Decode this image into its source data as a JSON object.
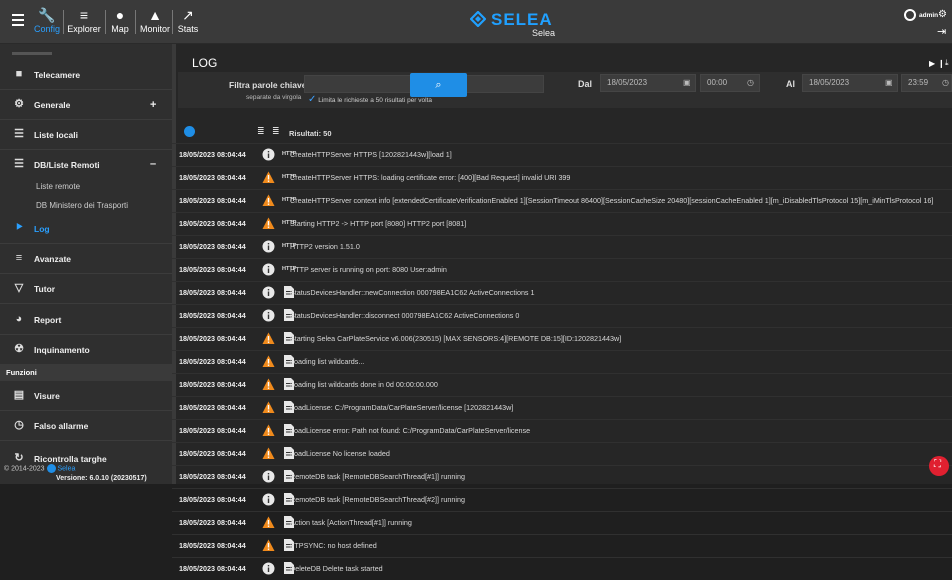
{
  "topbar": {
    "items": [
      {
        "label": "Config",
        "icon": "wrench-icon"
      },
      {
        "label": "Explorer",
        "icon": "list-search-icon"
      },
      {
        "label": "Map",
        "icon": "map-pin-icon"
      },
      {
        "label": "Monitor",
        "icon": "bell-icon"
      },
      {
        "label": "Stats",
        "icon": "chart-icon"
      }
    ],
    "brand": "SELEA",
    "brand_sub": "Selea",
    "user": "admin",
    "accent": "#1f8ee6"
  },
  "sidebar": {
    "items": [
      {
        "label": "Telecamere",
        "icon": "camera-icon"
      },
      {
        "label": "Generale",
        "icon": "gear-icon",
        "toggle": "+"
      },
      {
        "label": "Liste locali",
        "icon": "list-icon"
      },
      {
        "label": "DB/Liste Remoti",
        "icon": "menu-icon",
        "toggle": "–"
      },
      {
        "label": "Log",
        "icon": "key-icon"
      },
      {
        "label": "Avanzate",
        "icon": "sliders-icon"
      },
      {
        "label": "Tutor",
        "icon": "signal-icon"
      },
      {
        "label": "Report",
        "icon": "pie-icon"
      },
      {
        "label": "Inquinamento",
        "icon": "biohazard-icon"
      },
      {
        "label": "Visure",
        "icon": "card-icon"
      },
      {
        "label": "Falso allarme",
        "icon": "clock-icon"
      },
      {
        "label": "Ricontrolla targhe",
        "icon": "refresh-icon"
      }
    ],
    "subitems": [
      "Liste remote",
      "DB Ministero dei Trasporti"
    ],
    "section": "Funzioni",
    "footer_copy": "© 2014-2023",
    "footer_brand": "Selea",
    "version": "Versione: 6.0.10 (20230517)"
  },
  "main": {
    "title": "LOG",
    "filter_label": "Filtra parole chiave",
    "filter_sub": "separate da virgola",
    "limit_label": "Limita le richieste a 50 risultati per volta",
    "from_label": "Dal",
    "to_label": "Al",
    "from_date": "18/05/2023",
    "from_time": "00:00",
    "to_date": "18/05/2023",
    "to_time": "23:59",
    "results": "Risultati: 50"
  },
  "rows": [
    {
      "ts": "18/05/2023 08:04:44",
      "level": "info",
      "cat": "HTTP",
      "msg": "CreateHTTPServer HTTPS [1202821443w][load 1]"
    },
    {
      "ts": "18/05/2023 08:04:44",
      "level": "warn",
      "cat": "HTTP",
      "msg": "CreateHTTPServer HTTPS: loading certificate error: [400][Bad Request] invalid URI 399"
    },
    {
      "ts": "18/05/2023 08:04:44",
      "level": "warn",
      "cat": "HTTP",
      "msg": "CreateHTTPServer context info [extendedCertificateVerificationEnabled 1][SessionTimeout 86400][SessionCacheSize 20480][sessionCacheEnabled 1][m_iDisabledTlsProtocol 15][m_iMinTlsProtocol 16]"
    },
    {
      "ts": "18/05/2023 08:04:44",
      "level": "warn",
      "cat": "HTTP",
      "msg": "Starting HTTP2 -> HTTP port [8080] HTTP2 port [8081]"
    },
    {
      "ts": "18/05/2023 08:04:44",
      "level": "info",
      "cat": "HTTP",
      "msg": "HTTP2 version 1.51.0"
    },
    {
      "ts": "18/05/2023 08:04:44",
      "level": "info",
      "cat": "HTTP",
      "msg": "HTTP server is running on port: 8080 User:admin"
    },
    {
      "ts": "18/05/2023 08:04:44",
      "level": "info",
      "cat": "DOC",
      "msg": "StatusDevicesHandler::newConnection 000798EA1C62 ActiveConnections 1"
    },
    {
      "ts": "18/05/2023 08:04:44",
      "level": "info",
      "cat": "DOC",
      "msg": "StatusDevicesHandler::disconnect 000798EA1C62 ActiveConnections 0"
    },
    {
      "ts": "18/05/2023 08:04:44",
      "level": "warn",
      "cat": "DOC",
      "msg": "Starting Selea CarPlateService v6.006(230515) [MAX SENSORS:4][REMOTE DB:15][ID:1202821443w]"
    },
    {
      "ts": "18/05/2023 08:04:44",
      "level": "warn",
      "cat": "DOC",
      "msg": "Loading list wildcards..."
    },
    {
      "ts": "18/05/2023 08:04:44",
      "level": "warn",
      "cat": "DOC",
      "msg": "Loading list wildcards done in 0d 00:00:00.000"
    },
    {
      "ts": "18/05/2023 08:04:44",
      "level": "warn",
      "cat": "DOC",
      "msg": "LoadLicense: C:/ProgramData/CarPlateServer/license [1202821443w]"
    },
    {
      "ts": "18/05/2023 08:04:44",
      "level": "warn",
      "cat": "DOC",
      "msg": "LoadLicense error: Path not found: C:/ProgramData/CarPlateServer/license"
    },
    {
      "ts": "18/05/2023 08:04:44",
      "level": "warn",
      "cat": "DOC",
      "msg": "LoadLicense No license loaded"
    },
    {
      "ts": "18/05/2023 08:04:44",
      "level": "info",
      "cat": "DOC",
      "msg": "RemoteDB task [RemoteDBSearchThread[#1]] running"
    },
    {
      "ts": "18/05/2023 08:04:44",
      "level": "info",
      "cat": "DOC",
      "msg": "RemoteDB task [RemoteDBSearchThread[#2]] running"
    },
    {
      "ts": "18/05/2023 08:04:44",
      "level": "warn",
      "cat": "DOC",
      "msg": "Action task [ActionThread[#1]] running"
    },
    {
      "ts": "18/05/2023 08:04:44",
      "level": "warn",
      "cat": "DOC",
      "msg": "FTPSYNC: no host defined"
    },
    {
      "ts": "18/05/2023 08:04:44",
      "level": "info",
      "cat": "DOC",
      "msg": "DeleteDB Delete task started"
    }
  ]
}
